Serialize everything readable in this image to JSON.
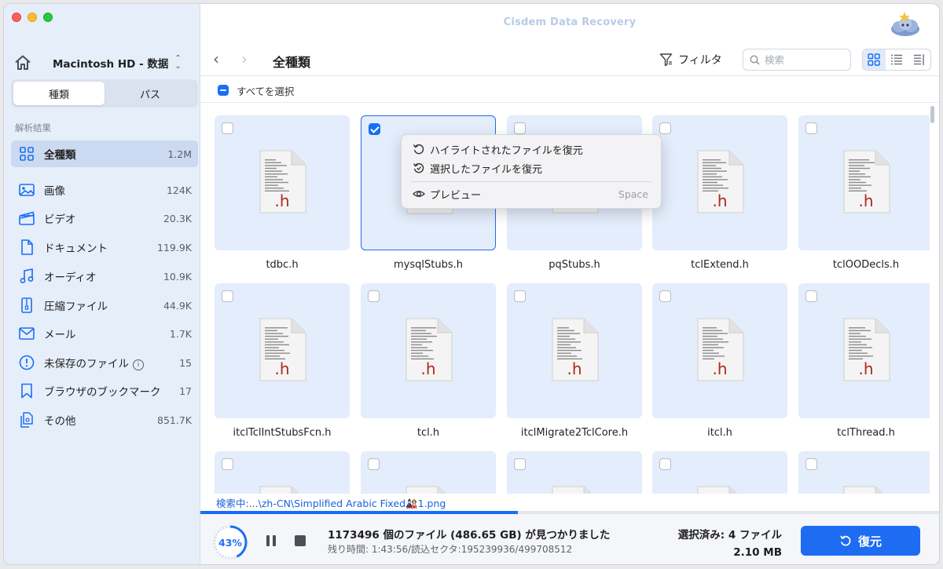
{
  "window": {
    "title": "Cisdem Data Recovery"
  },
  "sidebar": {
    "disk_name": "Macintosh  HD - 数据",
    "segments": [
      {
        "label": "種類",
        "active": true
      },
      {
        "label": "パス",
        "active": false
      }
    ],
    "section_label": "解析結果",
    "categories": [
      {
        "label": "全種類",
        "count": "1.2M",
        "icon": "grid-icon",
        "active": true
      },
      {
        "label": "画像",
        "count": "124K",
        "icon": "image-icon"
      },
      {
        "label": "ビデオ",
        "count": "20.3K",
        "icon": "video-icon"
      },
      {
        "label": "ドキュメント",
        "count": "119.9K",
        "icon": "document-icon"
      },
      {
        "label": "オーディオ",
        "count": "10.9K",
        "icon": "music-icon"
      },
      {
        "label": "圧縮ファイル",
        "count": "44.9K",
        "icon": "archive-icon"
      },
      {
        "label": "メール",
        "count": "1.7K",
        "icon": "mail-icon"
      },
      {
        "label": "未保存のファイル",
        "count": "15",
        "icon": "warning-icon",
        "info": "i"
      },
      {
        "label": "ブラウザのブックマーク",
        "count": "17",
        "icon": "bookmark-icon"
      },
      {
        "label": "その他",
        "count": "851.7K",
        "icon": "other-files-icon"
      }
    ]
  },
  "toolbar": {
    "folder_title": "全種類",
    "back": "‹",
    "forward": "›",
    "filter_label": "フィルタ",
    "search_placeholder": "検索"
  },
  "select_all_label": "すべてを選択",
  "files": [
    {
      "name": "tdbc.h",
      "ext": ".h",
      "checked": false
    },
    {
      "name": "mysqlStubs.h",
      "ext": ".h",
      "checked": true
    },
    {
      "name": "pqStubs.h",
      "ext": ".h",
      "checked": false
    },
    {
      "name": "tclExtend.h",
      "ext": ".h",
      "checked": false
    },
    {
      "name": "tclOODecls.h",
      "ext": ".h",
      "checked": false
    },
    {
      "name": "itclTclIntStubsFcn.h",
      "ext": ".h",
      "checked": false
    },
    {
      "name": "tcl.h",
      "ext": ".h",
      "checked": false
    },
    {
      "name": "itclMigrate2TclCore.h",
      "ext": ".h",
      "checked": false
    },
    {
      "name": "itcl.h",
      "ext": ".h",
      "checked": false
    },
    {
      "name": "tclThread.h",
      "ext": ".h",
      "checked": false
    },
    {
      "name": "",
      "ext": "",
      "checked": false
    },
    {
      "name": "",
      "ext": "",
      "checked": false
    },
    {
      "name": "",
      "ext": "",
      "checked": false
    },
    {
      "name": "",
      "ext": "",
      "checked": false
    },
    {
      "name": "",
      "ext": "",
      "checked": false
    }
  ],
  "context_menu": {
    "items": [
      {
        "label": "ハイライトされたファイルを復元",
        "icon": "restore-icon"
      },
      {
        "label": "選択したファイルを復元",
        "icon": "restore-selected-icon"
      },
      {
        "label": "プレビュー",
        "icon": "eye-icon",
        "shortcut": "Space"
      }
    ]
  },
  "status": {
    "path": "検索中:...\\zh-CN\\Simplified Arabic Fixed🎎1.png",
    "progress": 0.43
  },
  "scan": {
    "percent_label": "43%",
    "found_text": "1173496 個のファイル (486.65 GB) が見つかりました",
    "remaining_text": "残り時間: 1:43:56/読込セクタ:195239936/499708512"
  },
  "selection": {
    "count_text": "選択済み: 4 ファイル",
    "size_text": "2.10 MB"
  },
  "recover_label": "復元",
  "colors": {
    "accent": "#1a6ef5",
    "tile_bg": "#e3edfb",
    "sidebar_bg": "#e6eefa",
    "doc_ext": "#b3261e"
  }
}
